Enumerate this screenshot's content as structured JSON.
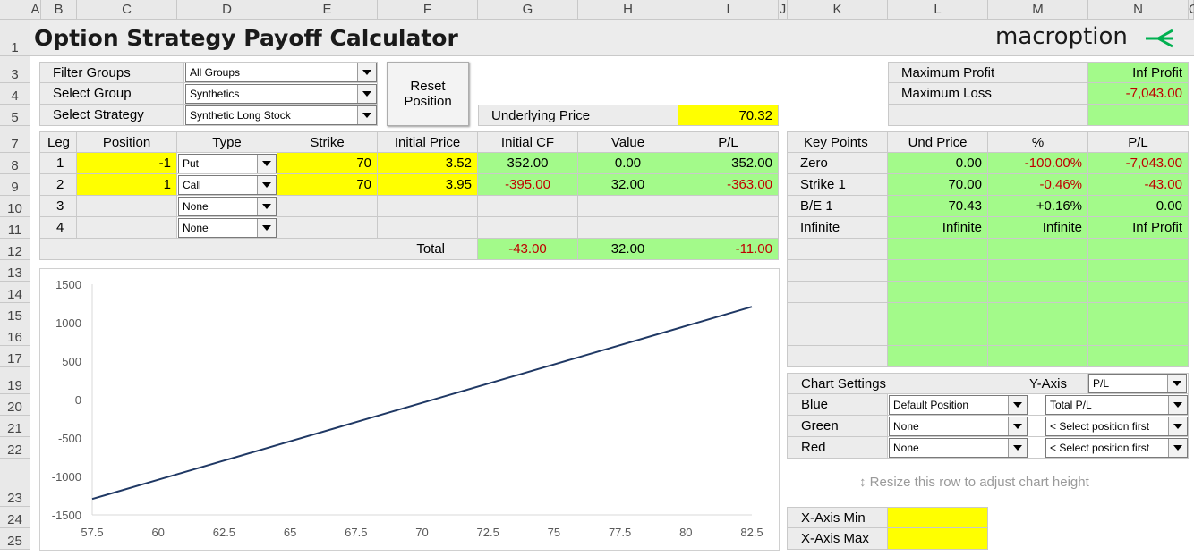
{
  "columns": [
    "A",
    "B",
    "C",
    "D",
    "E",
    "F",
    "G",
    "H",
    "I",
    "J",
    "K",
    "L",
    "M",
    "N",
    "O"
  ],
  "rows": [
    "1",
    "3",
    "4",
    "5",
    "7",
    "8",
    "9",
    "10",
    "11",
    "12",
    "13",
    "14",
    "15",
    "16",
    "17",
    "19",
    "20",
    "21",
    "22",
    "23",
    "24",
    "25"
  ],
  "title": "Option Strategy Payoff Calculator",
  "logo": {
    "text": "macroption",
    "accent": "#00b050"
  },
  "filters": [
    {
      "label": "Filter Groups",
      "value": "All Groups"
    },
    {
      "label": "Select Group",
      "value": "Synthetics"
    },
    {
      "label": "Select Strategy",
      "value": "Synthetic Long Stock"
    }
  ],
  "reset_button": {
    "line1": "Reset",
    "line2": "Position"
  },
  "underlying": {
    "label": "Underlying Price",
    "value": "70.32"
  },
  "summary": [
    {
      "label": "Maximum Profit",
      "value": "Inf Profit"
    },
    {
      "label": "Maximum Loss",
      "value": "-7,043.00"
    }
  ],
  "legs_table": {
    "headers": [
      "Leg",
      "Position",
      "Type",
      "Strike",
      "Initial Price",
      "Initial CF",
      "Value",
      "P/L"
    ],
    "rows": [
      {
        "leg": "1",
        "position": "-1",
        "type": "Put",
        "strike": "70",
        "initial_price": "3.52",
        "initial_cf": "352.00",
        "value": "0.00",
        "pl": "352.00"
      },
      {
        "leg": "2",
        "position": "1",
        "type": "Call",
        "strike": "70",
        "initial_price": "3.95",
        "initial_cf": "-395.00",
        "value": "32.00",
        "pl": "-363.00"
      },
      {
        "leg": "3",
        "position": "",
        "type": "None",
        "strike": "",
        "initial_price": "",
        "initial_cf": "",
        "value": "",
        "pl": ""
      },
      {
        "leg": "4",
        "position": "",
        "type": "None",
        "strike": "",
        "initial_price": "",
        "initial_cf": "",
        "value": "",
        "pl": ""
      }
    ],
    "total": {
      "label": "Total",
      "initial_cf": "-43.00",
      "value": "32.00",
      "pl": "-11.00"
    }
  },
  "key_points": {
    "headers": [
      "Key Points",
      "Und Price",
      "%",
      "P/L"
    ],
    "rows": [
      {
        "name": "Zero",
        "price": "0.00",
        "pct": "-100.00%",
        "pl": "-7,043.00"
      },
      {
        "name": "Strike 1",
        "price": "70.00",
        "pct": "-0.46%",
        "pl": "-43.00"
      },
      {
        "name": "B/E 1",
        "price": "70.43",
        "pct": "+0.16%",
        "pl": "0.00"
      },
      {
        "name": "Infinite",
        "price": "Infinite",
        "pct": "Infinite",
        "pl": "Inf Profit"
      }
    ]
  },
  "chart_settings": {
    "label": "Chart Settings",
    "y_axis_label": "Y-Axis",
    "y_axis_value": "P/L",
    "rows": [
      {
        "label": "Blue",
        "position": "Default Position",
        "series": "Total P/L"
      },
      {
        "label": "Green",
        "position": "None",
        "series": "< Select position first"
      },
      {
        "label": "Red",
        "position": "None",
        "series": "< Select position first"
      }
    ]
  },
  "resize_hint": "↕ Resize this row to adjust chart height",
  "x_axis": {
    "min_label": "X-Axis Min",
    "max_label": "X-Axis Max",
    "min": "",
    "max": ""
  },
  "chart_data": {
    "type": "line",
    "title": "",
    "xlabel": "",
    "ylabel": "",
    "xlim": [
      57.5,
      82.5
    ],
    "ylim": [
      -1500,
      1500
    ],
    "xticks": [
      "57.5",
      "60",
      "62.5",
      "65",
      "67.5",
      "70",
      "72.5",
      "75",
      "77.5",
      "80",
      "82.5"
    ],
    "yticks": [
      "1500",
      "1000",
      "500",
      "0",
      "-500",
      "-1000",
      "-1500"
    ],
    "grid": false,
    "series": [
      {
        "color": "#1f3864",
        "x": [
          57.5,
          60,
          62.5,
          65,
          67.5,
          70,
          72.5,
          75,
          77.5,
          80,
          82.5
        ],
        "y": [
          -1293,
          -1043,
          -793,
          -543,
          -293,
          -43,
          207,
          457,
          707,
          957,
          1207
        ]
      }
    ]
  }
}
